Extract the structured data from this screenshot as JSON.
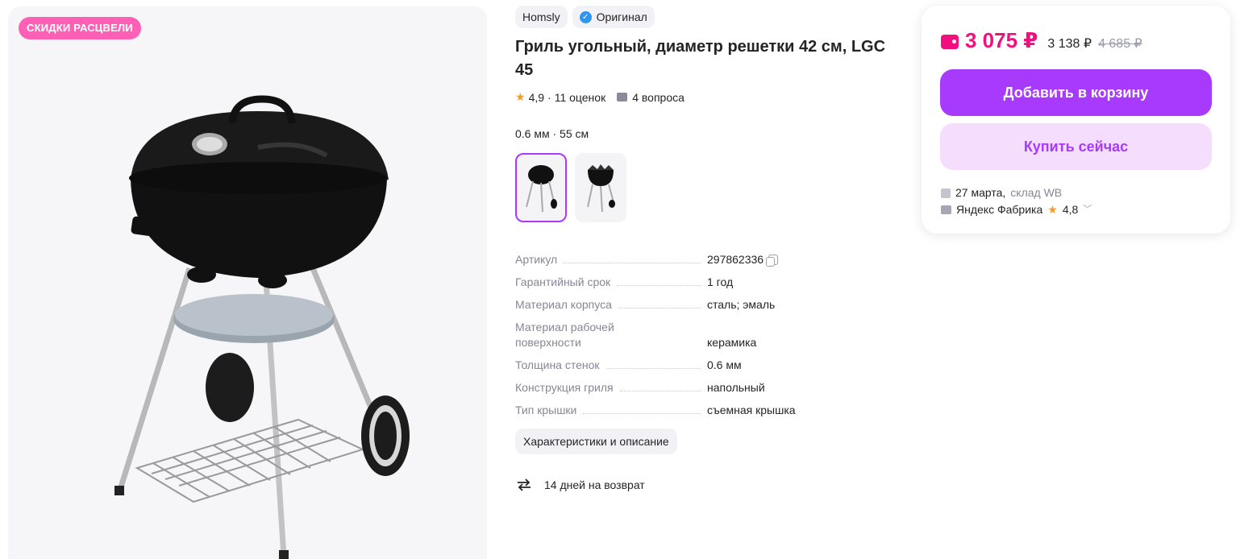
{
  "gallery": {
    "promo_badge": "СКИДКИ РАСЦВЕЛИ"
  },
  "product": {
    "brand": "Homsly",
    "original_label": "Оригинал",
    "title": "Гриль угольный, диаметр решетки 42 см, LGC 45",
    "rating": "4,9",
    "reviews": "11 оценок",
    "questions": "4 вопроса",
    "variant_label": "0.6 мм · 55 см"
  },
  "specs": [
    {
      "name": "Артикул",
      "value": "297862336"
    },
    {
      "name": "Гарантийный срок",
      "value": "1 год"
    },
    {
      "name": "Материал корпуса",
      "value": "сталь; эмаль"
    },
    {
      "name_line1": "Материал рабочей",
      "name_line2": "поверхности",
      "value": "керамика"
    },
    {
      "name": "Толщина стенок",
      "value": "0.6 мм"
    },
    {
      "name": "Конструкция гриля",
      "value": "напольный"
    },
    {
      "name": "Тип крышки",
      "value": "съемная крышка"
    }
  ],
  "description_button": "Характеристики и описание",
  "return_policy": "14 дней на возврат",
  "price_card": {
    "price": "3 075 ₽",
    "price_alt": "3 138 ₽",
    "price_old": "4 685 ₽",
    "add_to_cart": "Добавить в корзину",
    "buy_now": "Купить сейчас",
    "delivery_date": "27 марта,",
    "warehouse": "склад WB",
    "seller": "Яндекс Фабрика",
    "seller_rating": "4,8"
  },
  "colors": {
    "accent": "#a73afd",
    "price": "#f1117e",
    "promo": "#ff5fb4"
  }
}
